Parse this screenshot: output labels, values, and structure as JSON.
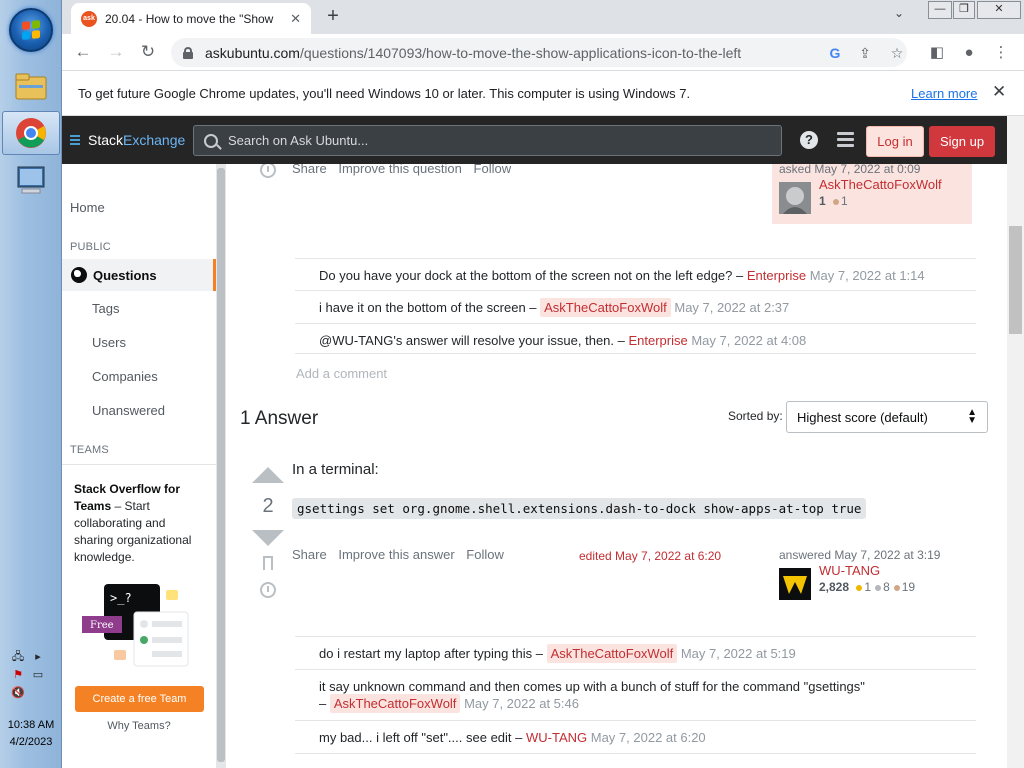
{
  "taskbar": {
    "clock_time": "10:38 AM",
    "clock_date": "4/2/2023"
  },
  "browser": {
    "tab_title": "20.04 - How to move the \"Show",
    "tab_favicon_text": "ask",
    "url_host": "askubuntu.com",
    "url_path": "/questions/1407093/how-to-move-the-show-applications-icon-to-the-left",
    "infobar_message": "To get future Google Chrome updates, you'll need Windows 10 or later. This computer is using Windows 7.",
    "infobar_link": "Learn more"
  },
  "topbar": {
    "logo_stack": "Stack",
    "logo_exchange": "Exchange",
    "search_placeholder": "Search on Ask Ubuntu...",
    "login": "Log in",
    "signup": "Sign up",
    "help_glyph": "?"
  },
  "leftnav": {
    "home": "Home",
    "public_head": "PUBLIC",
    "questions": "Questions",
    "tags": "Tags",
    "users": "Users",
    "companies": "Companies",
    "unanswered": "Unanswered",
    "teams_head": "TEAMS",
    "teams_title": "Stack Overflow for Teams",
    "teams_desc": " – Start collaborating and sharing organizational knowledge.",
    "teams_prompt": ">_?",
    "teams_free": "Free",
    "teams_cta": "Create a free Team",
    "why_teams": "Why Teams?"
  },
  "question": {
    "menu": [
      "Share",
      "Improve this question",
      "Follow"
    ],
    "asked_label": "asked May 7, 2022 at 0:09",
    "user_name": "AskTheCattoFoxWolf",
    "user_rep": "1",
    "user_bronze": "1",
    "comments": [
      {
        "text": "Do you have your dock at the bottom of the screen not on the left edge? – ",
        "user": "Enterprise",
        "date": "May 7, 2022 at 1:14"
      },
      {
        "text": "i have it on the bottom of the screen – ",
        "user": "AskTheCattoFoxWolf",
        "date": "May 7, 2022 at 2:37"
      },
      {
        "text": "@WU-TANG's answer will resolve your issue, then. – ",
        "user": "Enterprise",
        "date": "May 7, 2022 at 4:08"
      }
    ],
    "add_comment": "Add a comment"
  },
  "answers": {
    "count_label": "1 Answer",
    "sorted_by": "Sorted by:",
    "sort_value": "Highest score (default)"
  },
  "answer": {
    "score": "2",
    "text": "In a terminal:",
    "code": "gsettings set org.gnome.shell.extensions.dash-to-dock show-apps-at-top true",
    "menu": [
      "Share",
      "Improve this answer",
      "Follow"
    ],
    "edited": "edited May 7, 2022 at 6:20",
    "answered_label": "answered May 7, 2022 at 3:19",
    "user_name": "WU-TANG",
    "user_rep": "2,828",
    "gold": "1",
    "silver": "8",
    "bronze": "19",
    "comments": [
      {
        "text": "do i restart my laptop after typing this – ",
        "user": "AskTheCattoFoxWolf",
        "date": "May 7, 2022 at 5:19"
      },
      {
        "text": "it say unknown command and then comes up with a bunch of stuff for the command \"gsettings\"",
        "text2": "– ",
        "user": "AskTheCattoFoxWolf",
        "date": "May 7, 2022 at 5:46"
      },
      {
        "text": "my bad... i left off \"set\".... see edit – ",
        "user": "WU-TANG",
        "date": "May 7, 2022 at 6:20"
      }
    ]
  },
  "colors": {
    "accent": "#f48225",
    "user_red": "#c22e32",
    "topbar": "#252525"
  }
}
